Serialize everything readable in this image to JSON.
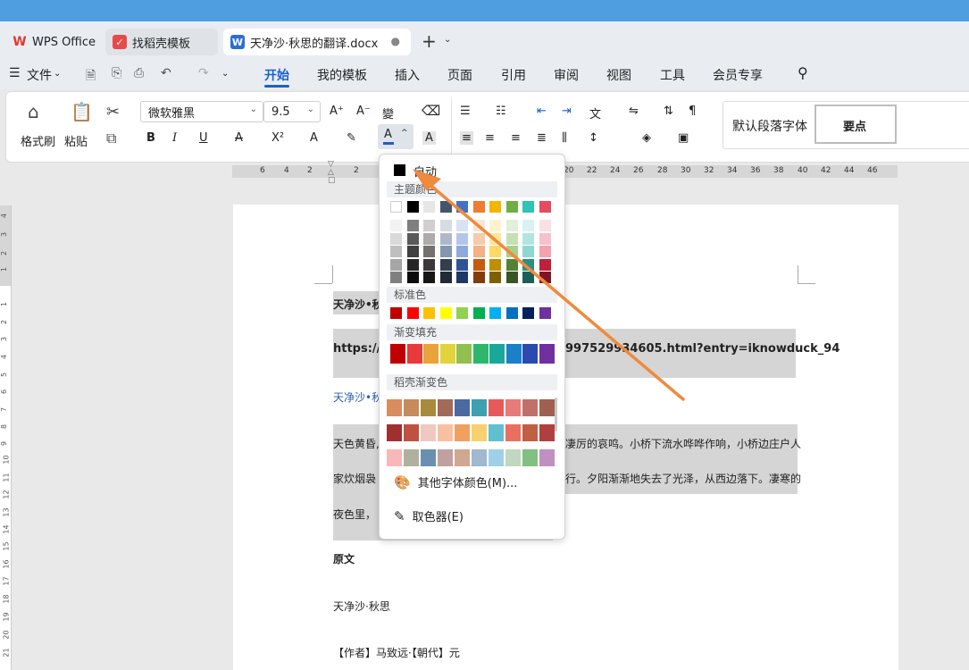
{
  "tabs": [
    {
      "label": "WPS Office",
      "icon": "wps-logo-icon"
    },
    {
      "label": "找稻壳模板",
      "icon": "docer-icon"
    },
    {
      "label": "天净沙·秋思的翻译.docx",
      "icon": "word-doc-icon"
    }
  ],
  "menu": {
    "file": "文件",
    "items": [
      "开始",
      "我的模板",
      "插入",
      "页面",
      "引用",
      "审阅",
      "视图",
      "工具",
      "会员专享"
    ],
    "active": "开始"
  },
  "ribbon": {
    "format_painter": "格式刷",
    "paste": "粘贴",
    "font_name": "微软雅黑",
    "font_size": "9.5",
    "style_default": "默认段落字体",
    "style_key": "要点"
  },
  "ruler": {
    "numbers": [
      "6",
      "4",
      "2",
      "2",
      "20",
      "22",
      "24",
      "26",
      "28",
      "30",
      "32",
      "34",
      "36",
      "38",
      "40",
      "42",
      "44",
      "46"
    ]
  },
  "vruler": {
    "numbers": [
      "4",
      "3",
      "2",
      "1",
      "1",
      "2",
      "3",
      "4",
      "5",
      "6",
      "7",
      "8",
      "9",
      "10",
      "11",
      "12",
      "13",
      "14",
      "15",
      "16",
      "17",
      "18",
      "19",
      "20",
      "21"
    ]
  },
  "document": {
    "line1": "天净沙•秋",
    "line2a": "https://z",
    "line2b": "997529934605.html?entry=iknowduck_94",
    "line3": "天净沙•秋",
    "line4a": "天色黄昏,",
    "line4b": "凄厉的哀鸣。小桥下流水哗哗作响，小桥边庄户人",
    "line5a": "家炊烟袅",
    "line5b": "行。夕阳渐渐地失去了光泽，从西边落下。凄寒的",
    "line6": "夜色里，",
    "heading": "原文",
    "title": "天净沙·秋思",
    "author": "【作者】马致远·【朝代】元"
  },
  "color_popup": {
    "auto": "自动",
    "theme": "主题颜色",
    "standard": "标准色",
    "gradient": "渐变填充",
    "docer_gradient": "稻壳渐变色",
    "more_colors": "其他字体颜色(M)...",
    "picker": "取色器(E)",
    "theme_top": [
      "#ffffff",
      "#000000",
      "#e7e6e6",
      "#44546a",
      "#4472c4",
      "#ed7d31",
      "#a5a5a5",
      "#ffc000",
      "#5b9bd5",
      "#70ad47"
    ],
    "theme_columns": [
      [
        "#f2f2f2",
        "#d9d9d9",
        "#bfbfbf",
        "#a6a6a6",
        "#808080"
      ],
      [
        "#7f7f7f",
        "#595959",
        "#404040",
        "#262626",
        "#0d0d0d"
      ],
      [
        "#d0cece",
        "#aeabab",
        "#757171",
        "#3a3838",
        "#171616"
      ],
      [
        "#d6dce4",
        "#adb9ca",
        "#8496b0",
        "#333f4f",
        "#222a35"
      ],
      [
        "#d9e2f3",
        "#b4c6e7",
        "#8eaadb",
        "#2f5496",
        "#1f3864"
      ],
      [
        "#fbe4d5",
        "#f7caac",
        "#f4b183",
        "#c55a11",
        "#843c0c"
      ],
      [
        "#fff2cc",
        "#ffe699",
        "#ffd966",
        "#bf8f00",
        "#7f6000"
      ],
      [
        "#e2efd9",
        "#c5e0b3",
        "#a8d08d",
        "#538135",
        "#375623"
      ],
      [
        "#d9f2f0",
        "#b3e5e0",
        "#8dd8d0",
        "#2a8f84",
        "#1c5f58"
      ],
      [
        "#fbe0e4",
        "#f7c1c9",
        "#f3a2ae",
        "#c0203a",
        "#801526"
      ]
    ],
    "theme_top_real": [
      "#ffffff",
      "#000000",
      "#e7e6e6",
      "#44546a",
      "#4472c4",
      "#ed7d31",
      "#f4b400",
      "#70ad47",
      "#2ec4b6",
      "#e84a5f"
    ],
    "standard_colors": [
      "#c00000",
      "#ff0000",
      "#ffc000",
      "#ffff00",
      "#92d050",
      "#00b050",
      "#00b0f0",
      "#0070c0",
      "#002060",
      "#7030a0"
    ],
    "gradient_colors": [
      "#c00000",
      "#e83a3a",
      "#e8a33a",
      "#e0d43a",
      "#92c050",
      "#2cb86a",
      "#1aa89a",
      "#1a80c8",
      "#2a4ab0",
      "#7030a0"
    ],
    "docer_rows": [
      [
        "#d98c5f",
        "#c78a5a",
        "#a88a3e",
        "#a36a5a",
        "#4a6aa0",
        "#3ea0b0",
        "#e85a5a",
        "#e87a7a",
        "#c0706a",
        "#a06050"
      ],
      [
        "#a03030",
        "#c05040",
        "#f0c8c0",
        "#f8c0a0",
        "#f0a060",
        "#f8d070",
        "#60c0d0",
        "#e87060",
        "#c06040",
        "#b04040"
      ],
      [
        "#f8b8b8",
        "#b0b0a0",
        "#6a90b0",
        "#c0a0a0",
        "#d0a890",
        "#a0b8d0",
        "#a0d0e8",
        "#c0d8c0",
        "#80c080",
        "#c090c0"
      ]
    ]
  }
}
